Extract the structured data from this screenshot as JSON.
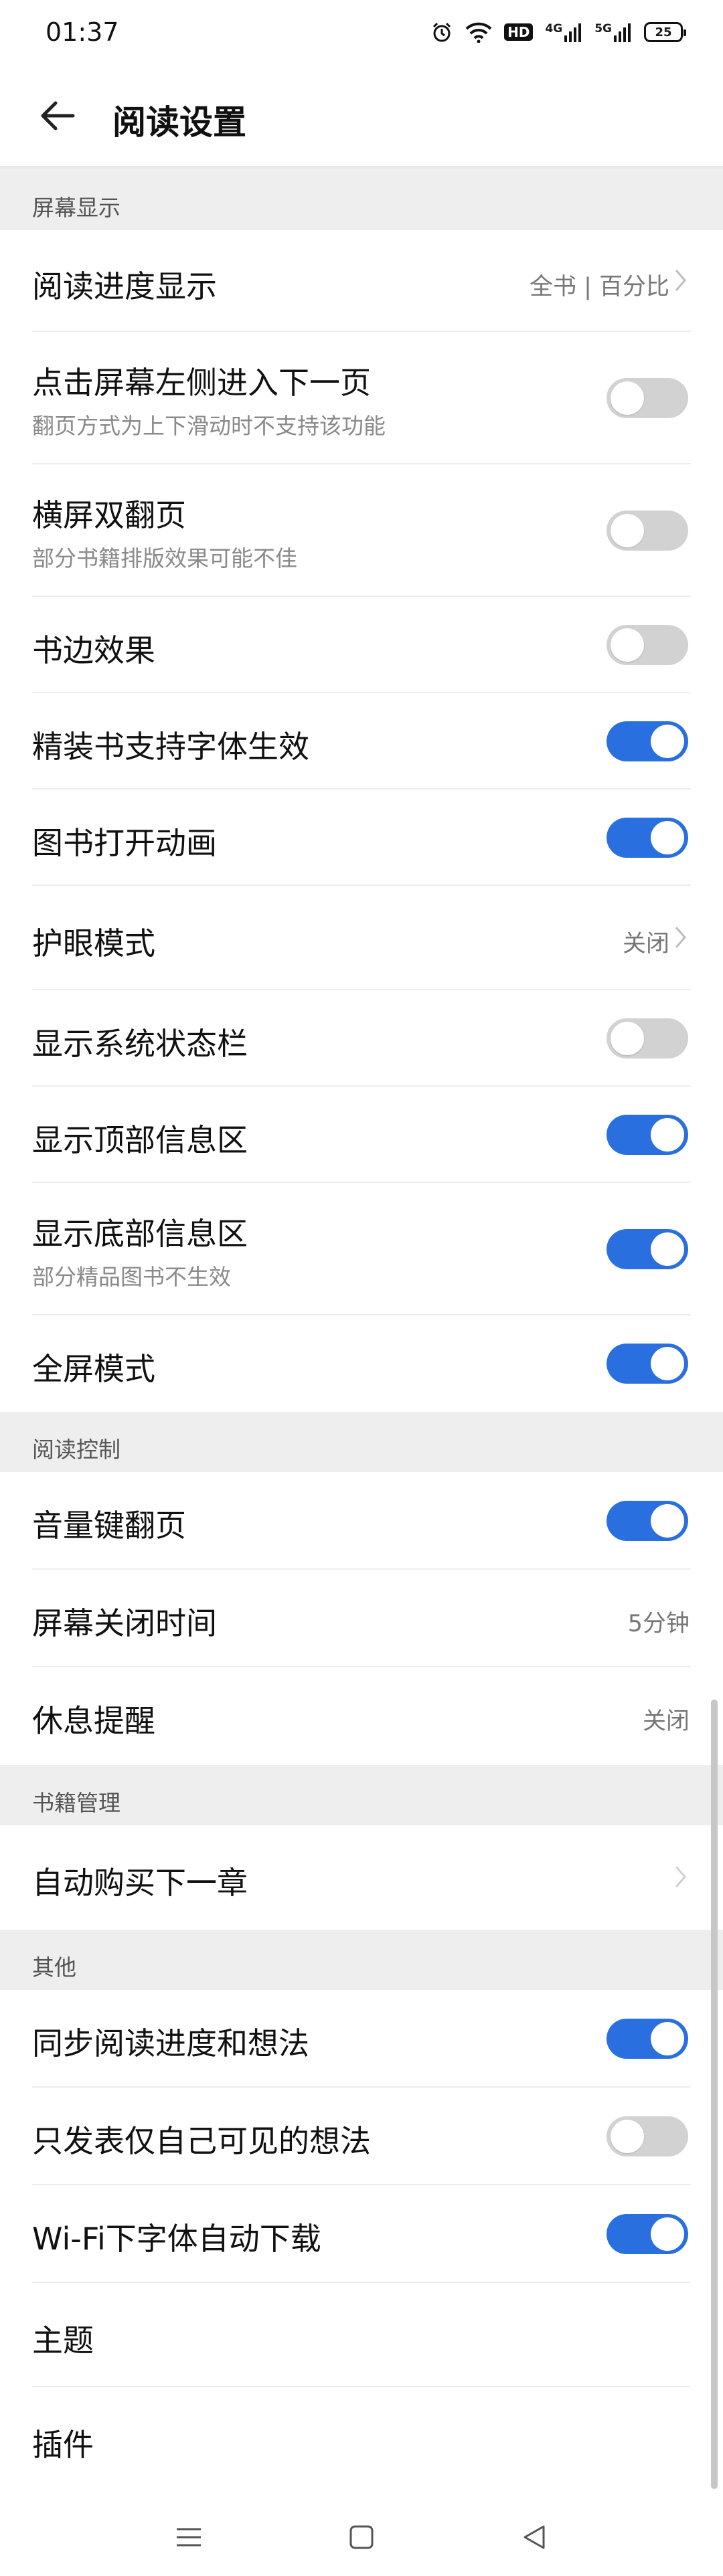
{
  "status_bar": {
    "time": "01:37",
    "hd": "HD",
    "sig1": "4G",
    "sig2": "5G",
    "battery": "25"
  },
  "app_bar": {
    "title": "阅读设置"
  },
  "colors": {
    "accent": "#2a6fe0",
    "toggle_off": "#d2d2d2",
    "section_bg": "#eeeeee"
  },
  "sections": {
    "screen_display": "屏幕显示",
    "reading_control": "阅读控制",
    "book_management": "书籍管理",
    "other": "其他"
  },
  "rows": {
    "progress": {
      "title": "阅读进度显示",
      "value": "全书 | 百分比"
    },
    "tap_left": {
      "title": "点击屏幕左侧进入下一页",
      "subtitle": "翻页方式为上下滑动时不支持该功能",
      "on": false
    },
    "landscape_double": {
      "title": "横屏双翻页",
      "subtitle": "部分书籍排版效果可能不佳",
      "on": false
    },
    "book_edge": {
      "title": "书边效果",
      "on": false
    },
    "fine_font": {
      "title": "精装书支持字体生效",
      "on": true
    },
    "open_anim": {
      "title": "图书打开动画",
      "on": true
    },
    "eye_care": {
      "title": "护眼模式",
      "value": "关闭"
    },
    "sys_status": {
      "title": "显示系统状态栏",
      "on": false
    },
    "top_info": {
      "title": "显示顶部信息区",
      "on": true
    },
    "bottom_info": {
      "title": "显示底部信息区",
      "subtitle": "部分精品图书不生效",
      "on": true
    },
    "fullscreen": {
      "title": "全屏模式",
      "on": true
    },
    "volume_key": {
      "title": "音量键翻页",
      "on": true
    },
    "screen_off": {
      "title": "屏幕关闭时间",
      "value": "5分钟"
    },
    "rest_remind": {
      "title": "休息提醒",
      "value": "关闭"
    },
    "auto_buy": {
      "title": "自动购买下一章"
    },
    "sync_progress": {
      "title": "同步阅读进度和想法",
      "on": true
    },
    "private_thoughts": {
      "title": "只发表仅自己可见的想法",
      "on": false
    },
    "wifi_font": {
      "title": "Wi-Fi下字体自动下载",
      "on": true
    },
    "theme": {
      "title": "主题"
    },
    "plugins": {
      "title": "插件"
    }
  }
}
